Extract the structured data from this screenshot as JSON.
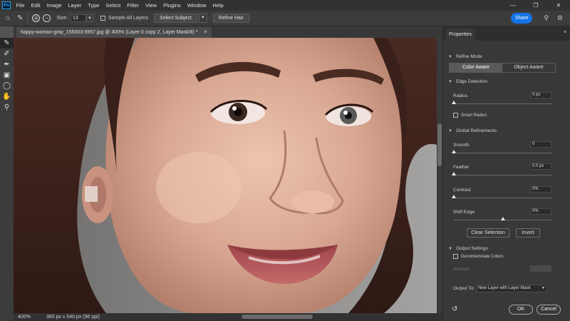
{
  "menubar": {
    "logo": "Ps",
    "items": [
      "File",
      "Edit",
      "Image",
      "Layer",
      "Type",
      "Select",
      "Filter",
      "View",
      "Plugins",
      "Window",
      "Help"
    ]
  },
  "options": {
    "size_label": "Size:",
    "size_value": "13",
    "sample_all_layers": "Sample All Layers",
    "select_subject": "Select Subject",
    "refine_hair": "Refine Hair",
    "share": "Share"
  },
  "document": {
    "tab_title": "happy-woman-gray_155003-5957.jpg @ 400% (Layer 0 copy 2, Layer Mask/8) *",
    "zoom": "400%",
    "dimensions": "360 px x 540 px (96 ppi)"
  },
  "properties": {
    "tab": "Properties",
    "refine_mode_title": "Refine Mode",
    "mode_color_aware": "Color Aware",
    "mode_object_aware": "Object Aware",
    "edge_detection_title": "Edge Detection",
    "radius_label": "Radius",
    "radius_value": "0 px",
    "smart_radius": "Smart Radius",
    "global_refinements_title": "Global Refinements",
    "smooth_label": "Smooth",
    "smooth_value": "0",
    "feather_label": "Feather",
    "feather_value": "0.0 px",
    "contrast_label": "Contrast",
    "contrast_value": "0%",
    "shift_edge_label": "Shift Edge",
    "shift_edge_value": "0%",
    "clear_selection": "Clear Selection",
    "invert": "Invert",
    "output_settings_title": "Output Settings",
    "decontaminate": "Decontaminate Colors",
    "amount_label": "Amount",
    "output_to_label": "Output To:",
    "output_to_value": "New Layer with Layer Mask",
    "ok": "OK",
    "cancel": "Cancel"
  },
  "icons": {
    "tools": [
      "quick-selection-brush-icon",
      "refine-edge-brush-icon",
      "brush-icon",
      "object-selection-icon",
      "lasso-icon",
      "hand-icon",
      "zoom-icon"
    ]
  },
  "colors": {
    "accent": "#1473e6"
  }
}
